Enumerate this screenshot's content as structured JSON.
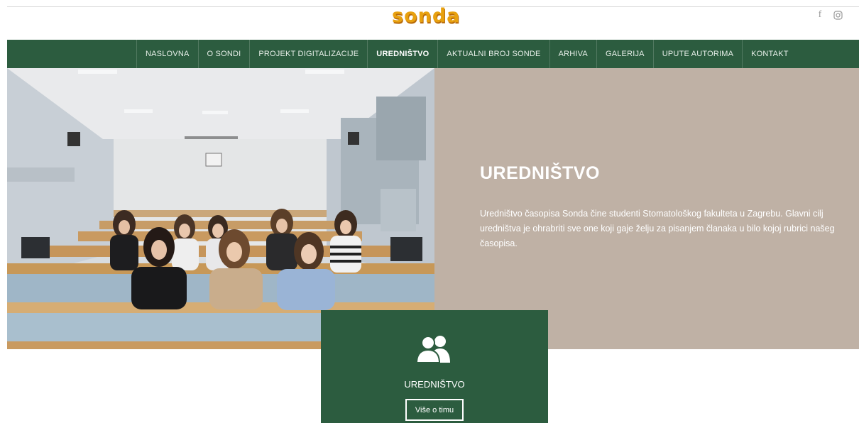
{
  "header": {
    "logo_text": "sonda",
    "social": [
      {
        "name": "facebook-icon",
        "glyph": "f"
      },
      {
        "name": "instagram-icon"
      }
    ]
  },
  "nav": {
    "items": [
      {
        "label": "NASLOVNA",
        "active": false
      },
      {
        "label": "O SONDI",
        "active": false
      },
      {
        "label": "PROJEKT DIGITALIZACIJE",
        "active": false
      },
      {
        "label": "UREDNIŠTVO",
        "active": true
      },
      {
        "label": "AKTUALNI BROJ SONDE",
        "active": false
      },
      {
        "label": "ARHIVA",
        "active": false
      },
      {
        "label": "GALERIJA",
        "active": false
      },
      {
        "label": "UPUTE AUTORIMA",
        "active": false
      },
      {
        "label": "KONTAKT",
        "active": false
      }
    ]
  },
  "hero": {
    "title": "UREDNIŠTVO",
    "text": "Uredništvo časopisa Sonda čine studenti Stomatološkog fakulteta u Zagrebu. Glavni cilj uredništva je ohrabriti sve one koji gaje želju za pisanjem članaka u bilo kojoj rubrici našeg časopisa."
  },
  "card": {
    "icon": "users-icon",
    "title": "UREDNIŠTVO",
    "button_label": "Više o timu"
  },
  "colors": {
    "brand_green": "#2c5c3f",
    "panel_beige": "#bfb1a5",
    "logo_orange": "#e8a10f"
  }
}
